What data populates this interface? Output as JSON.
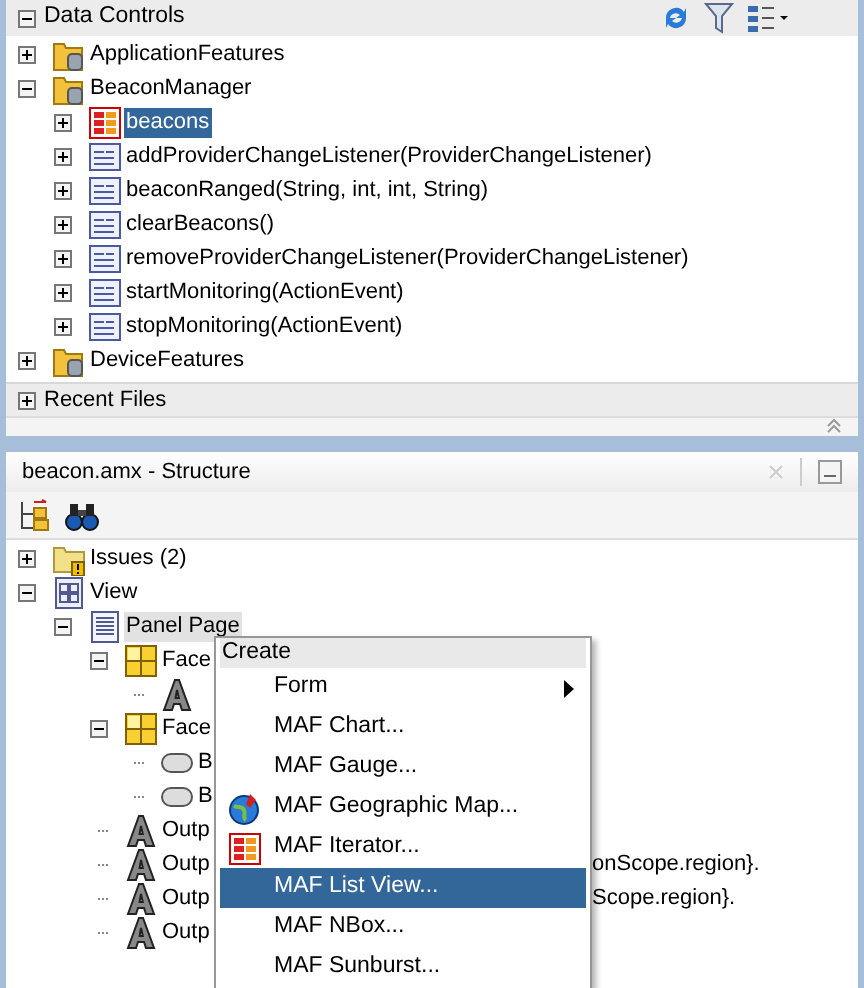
{
  "data_controls": {
    "title": "Data Controls",
    "expanded": true,
    "tree": [
      {
        "label": "ApplicationFeatures",
        "kind": "data-control",
        "expanded": false,
        "selected": false
      },
      {
        "label": "BeaconManager",
        "kind": "data-control",
        "expanded": true,
        "selected": false,
        "children": [
          {
            "label": "beacons",
            "kind": "collection",
            "expanded": false,
            "selected": true
          },
          {
            "label": "addProviderChangeListener(ProviderChangeListener)",
            "kind": "method",
            "expanded": false,
            "selected": false
          },
          {
            "label": "beaconRanged(String, int, int, String)",
            "kind": "method",
            "expanded": false,
            "selected": false
          },
          {
            "label": "clearBeacons()",
            "kind": "method",
            "expanded": false,
            "selected": false
          },
          {
            "label": "removeProviderChangeListener(ProviderChangeListener)",
            "kind": "method",
            "expanded": false,
            "selected": false
          },
          {
            "label": "startMonitoring(ActionEvent)",
            "kind": "method",
            "expanded": false,
            "selected": false
          },
          {
            "label": "stopMonitoring(ActionEvent)",
            "kind": "method",
            "expanded": false,
            "selected": false
          }
        ]
      },
      {
        "label": "DeviceFeatures",
        "kind": "data-control",
        "expanded": false,
        "selected": false
      }
    ]
  },
  "recent_files": {
    "title": "Recent Files",
    "expanded": false
  },
  "structure": {
    "title": "beacon.amx - Structure",
    "tree": [
      {
        "label": "Issues (2)",
        "kind": "issues",
        "expanded": false,
        "selected": false
      },
      {
        "label": "View",
        "kind": "view",
        "expanded": true,
        "selected": false,
        "children": [
          {
            "label": "Panel Page",
            "kind": "page",
            "expanded": true,
            "selected": true,
            "children": [
              {
                "label": "Face",
                "kind": "facet",
                "expanded": true,
                "selected": false,
                "children": [
                  {
                    "kind": "output"
                  }
                ]
              },
              {
                "label": "Face",
                "kind": "facet",
                "expanded": true,
                "selected": false,
                "children": [
                  {
                    "label": "B",
                    "kind": "button",
                    "selected": false
                  },
                  {
                    "label": "B",
                    "kind": "button",
                    "selected": false
                  }
                ]
              },
              {
                "label": "Outp",
                "kind": "output",
                "selected": false
              },
              {
                "label": "Outp",
                "kind": "output",
                "selected": false,
                "trailing_text": "onScope.region}."
              },
              {
                "label": "Outp",
                "kind": "output",
                "selected": false,
                "trailing_text": "Scope.region}."
              },
              {
                "label": "Outp",
                "kind": "output",
                "selected": false
              }
            ]
          }
        ]
      }
    ]
  },
  "context_menu": {
    "header": "Create",
    "items": [
      {
        "label": "Form",
        "submenu": true,
        "selected": false
      },
      {
        "label": "MAF Chart...",
        "submenu": false,
        "selected": false
      },
      {
        "label": "MAF Gauge...",
        "submenu": false,
        "selected": false
      },
      {
        "label": "MAF Geographic Map...",
        "kind": "map",
        "submenu": false,
        "selected": false
      },
      {
        "label": "MAF Iterator...",
        "kind": "iterator",
        "submenu": false,
        "selected": false
      },
      {
        "label": "MAF List View...",
        "submenu": false,
        "selected": true
      },
      {
        "label": "MAF NBox...",
        "submenu": false,
        "selected": false
      },
      {
        "label": "MAF Sunburst...",
        "submenu": false,
        "selected": false
      }
    ]
  }
}
